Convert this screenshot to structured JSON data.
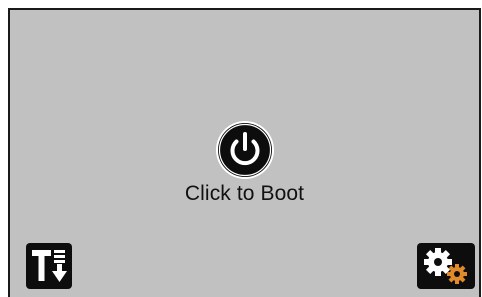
{
  "boot": {
    "label": "Click to Boot",
    "icon": "power-icon"
  },
  "toolbar": {
    "left_icon": "text-download-icon",
    "right_icon": "settings-gears-icon"
  },
  "colors": {
    "screen_background": "#c1c1c1",
    "icon_dark": "#0d0d0d",
    "icon_light": "#ffffff",
    "gear_accent": "#e08a2c"
  }
}
